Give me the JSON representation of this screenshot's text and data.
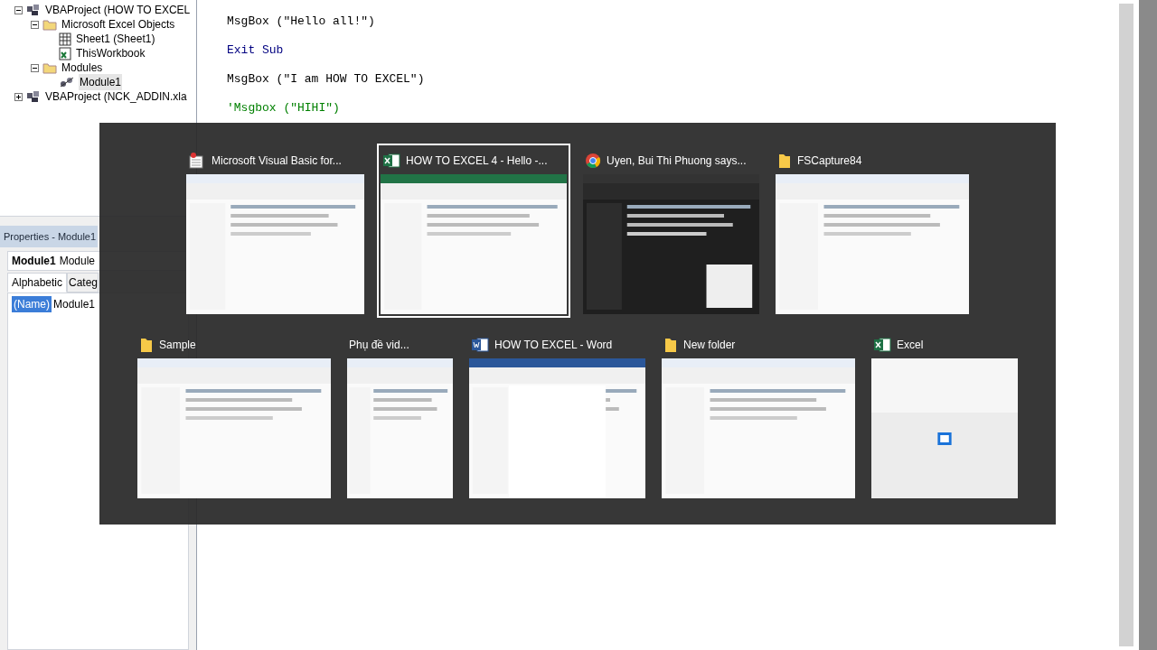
{
  "project_tree": [
    {
      "label": "VBAProject (HOW TO EXCEL",
      "kind": "project",
      "expanded": true,
      "children": [
        {
          "label": "Microsoft Excel Objects",
          "kind": "folder",
          "expanded": true,
          "children": [
            {
              "label": "Sheet1 (Sheet1)",
              "kind": "sheet",
              "selected": false
            },
            {
              "label": "ThisWorkbook",
              "kind": "workbook",
              "selected": false
            }
          ]
        },
        {
          "label": "Modules",
          "kind": "folder",
          "expanded": true,
          "children": [
            {
              "label": "Module1",
              "kind": "module",
              "selected": true
            }
          ]
        }
      ]
    },
    {
      "label": "VBAProject (NCK_ADDIN.xla",
      "kind": "project",
      "expanded": false
    }
  ],
  "code_lines": [
    {
      "text": "MsgBox (\"Hello all!\")",
      "kind": "code"
    },
    {
      "text": "Exit Sub",
      "kind": "keyword"
    },
    {
      "text": "MsgBox (\"I am HOW TO EXCEL\")",
      "kind": "code"
    },
    {
      "text": "'Msgbox (\"HIHI\")",
      "kind": "comment"
    }
  ],
  "properties": {
    "title": "Properties - Module1",
    "object_name": "Module1",
    "object_type": "Module",
    "tabs": [
      {
        "label": "Alphabetic",
        "selected": true
      },
      {
        "label": "Categ",
        "selected": false
      }
    ],
    "rows": [
      {
        "name": "(Name)",
        "value": "Module1",
        "selected": true
      }
    ]
  },
  "switcher": {
    "windows": [
      {
        "title": "Microsoft Visual Basic for...",
        "kind": "vba",
        "selected": false
      },
      {
        "title": "HOW TO EXCEL 4 - Hello -...",
        "kind": "excel",
        "selected": true
      },
      {
        "title": "Uyen, Bui Thi Phuong says...",
        "kind": "chrome",
        "selected": false
      },
      {
        "title": "FSCapture84",
        "kind": "folder",
        "selected": false
      },
      {
        "title": "Sample",
        "kind": "folder",
        "selected": false
      },
      {
        "title": "Phụ đề vid...",
        "kind": "none",
        "selected": false
      },
      {
        "title": "HOW TO EXCEL - Word",
        "kind": "word",
        "selected": false
      },
      {
        "title": "New folder",
        "kind": "folder",
        "selected": false
      },
      {
        "title": "Excel",
        "kind": "excel-splash",
        "selected": false
      }
    ]
  }
}
